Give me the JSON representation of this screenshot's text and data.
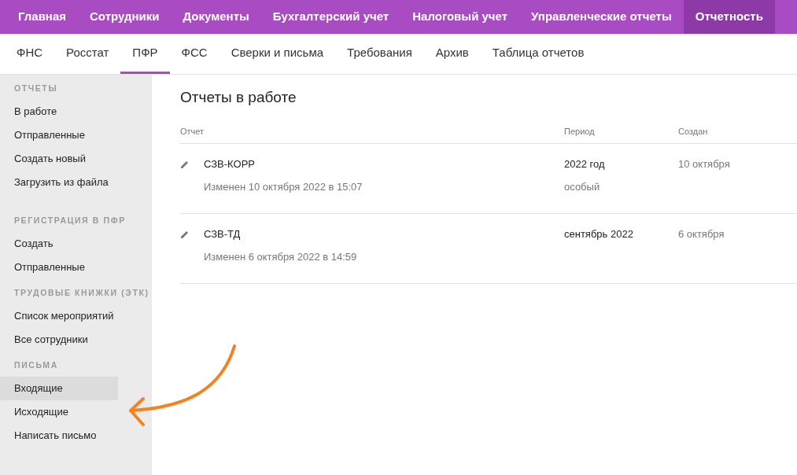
{
  "top_nav": [
    {
      "label": "Главная",
      "selected": false
    },
    {
      "label": "Сотрудники",
      "selected": false
    },
    {
      "label": "Документы",
      "selected": false
    },
    {
      "label": "Бухгалтерский учет",
      "selected": false
    },
    {
      "label": "Налоговый учет",
      "selected": false
    },
    {
      "label": "Управленческие отчеты",
      "selected": false
    },
    {
      "label": "Отчетность",
      "selected": true
    }
  ],
  "sub_nav": [
    {
      "label": "ФНС",
      "selected": false
    },
    {
      "label": "Росстат",
      "selected": false
    },
    {
      "label": "ПФР",
      "selected": true
    },
    {
      "label": "ФСС",
      "selected": false
    },
    {
      "label": "Сверки и письма",
      "selected": false
    },
    {
      "label": "Требования",
      "selected": false
    },
    {
      "label": "Архив",
      "selected": false
    },
    {
      "label": "Таблица отчетов",
      "selected": false
    }
  ],
  "sidebar": {
    "sections": [
      {
        "title": "ОТЧЕТЫ",
        "items": [
          {
            "label": "В работе",
            "selected": false
          },
          {
            "label": "Отправленные",
            "selected": false
          },
          {
            "label": "Создать новый",
            "selected": false
          },
          {
            "label": "Загрузить из файла",
            "selected": false
          }
        ]
      },
      {
        "title": "РЕГИСТРАЦИЯ В ПФР",
        "items": [
          {
            "label": "Создать",
            "selected": false
          },
          {
            "label": "Отправленные",
            "selected": false
          }
        ]
      },
      {
        "title": "ТРУДОВЫЕ КНИЖКИ (ЭТК)",
        "items": [
          {
            "label": "Список мероприятий",
            "selected": false
          },
          {
            "label": "Все сотрудники",
            "selected": false
          }
        ]
      },
      {
        "title": "ПИСЬМА",
        "items": [
          {
            "label": "Входящие",
            "selected": true
          },
          {
            "label": "Исходящие",
            "selected": false
          },
          {
            "label": "Написать письмо",
            "selected": false
          }
        ]
      }
    ]
  },
  "main": {
    "title": "Отчеты в работе",
    "table": {
      "columns": [
        "Отчет",
        "Период",
        "Создан"
      ],
      "rows": [
        {
          "name": "СЗВ-КОРР",
          "modified": "Изменен 10 октября 2022 в 15:07",
          "period": "2022 год",
          "period_note": "особый",
          "created": "10 октября"
        },
        {
          "name": "СЗВ-ТД",
          "modified": "Изменен 6 октября 2022 в 14:59",
          "period": "сентябрь 2022",
          "created": "6 октября"
        }
      ]
    }
  }
}
